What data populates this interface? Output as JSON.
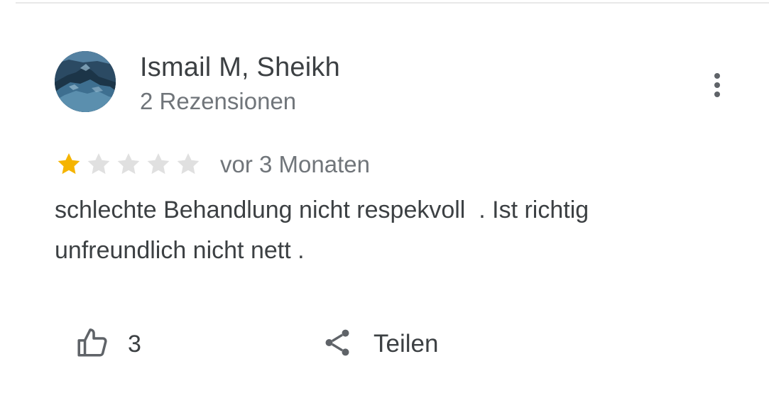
{
  "review": {
    "author_name": "Ismail M, Sheikh",
    "author_meta": "2 Rezensionen",
    "avatar_icon": "user-photo",
    "rating": 1,
    "rating_max": 5,
    "date": "vor 3 Monaten",
    "text": "schlechte Behandlung nicht respekvoll  . Ist richtig\nunfreundlich nicht nett ."
  },
  "actions": {
    "like_icon": "thumbs-up-icon",
    "like_count": "3",
    "share_icon": "share-icon",
    "share_label": "Teilen",
    "more_icon": "more-vert-icon"
  },
  "colors": {
    "star_filled": "#f5b400",
    "star_empty": "#e0e0e0",
    "text_primary": "#3c4043",
    "text_secondary": "#70757a"
  }
}
